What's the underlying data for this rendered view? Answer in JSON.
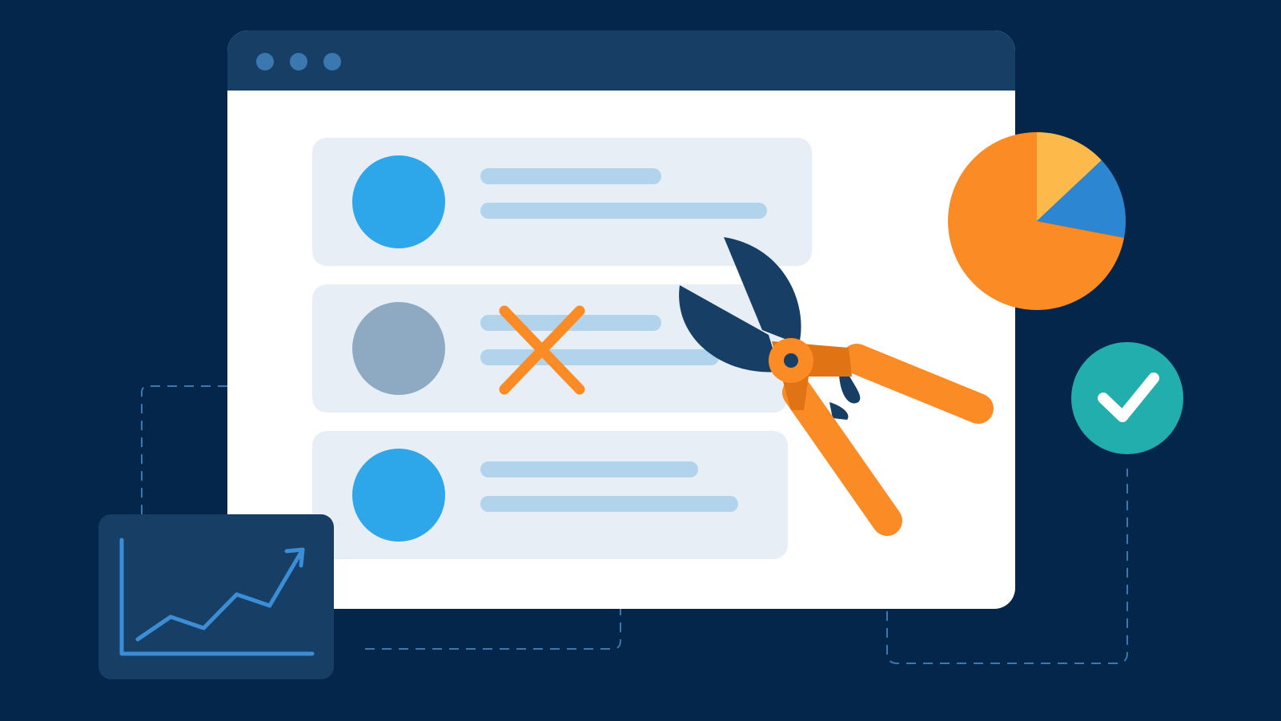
{
  "colors": {
    "background": "#03264a",
    "window_titlebar": "#173f66",
    "window_dots": "#3b78b0",
    "window_body": "#ffffff",
    "card": "#e7eef5",
    "avatar_active": "#2ea6ea",
    "avatar_removed": "#8eaac3",
    "text_line": "#b2d3ec",
    "accent_orange": "#fb8b24",
    "accent_orange_dark": "#e07314",
    "pie_yellow": "#fdba4a",
    "pie_blue": "#2c86d1",
    "shears_blade": "#173f66",
    "check_badge": "#23aeae",
    "chart_panel": "#173f66",
    "chart_line": "#3b8ed6",
    "connector": "#3b78b0"
  },
  "window": {
    "dots": [
      "window-dot-1",
      "window-dot-2",
      "window-dot-3"
    ]
  },
  "list": {
    "items": [
      {
        "state": "kept",
        "avatar_color": "#2ea6ea"
      },
      {
        "state": "removed",
        "avatar_color": "#8eaac3",
        "mark": "x-mark-icon"
      },
      {
        "state": "kept",
        "avatar_color": "#2ea6ea"
      }
    ]
  },
  "icons": {
    "shears": "pruning-shears-icon",
    "check": "checkmark-icon",
    "remove": "x-mark-icon",
    "trend": "trend-up-arrow-icon"
  },
  "pie": {
    "slices": [
      {
        "label": "",
        "value": 0.13,
        "color": "#fdba4a"
      },
      {
        "label": "",
        "value": 0.15,
        "color": "#2c86d1"
      },
      {
        "label": "",
        "value": 0.72,
        "color": "#fb8b24"
      }
    ]
  },
  "trend_chart": {
    "type": "line",
    "points": [
      {
        "x": 0,
        "y": 1
      },
      {
        "x": 1,
        "y": 3
      },
      {
        "x": 2,
        "y": 2
      },
      {
        "x": 3,
        "y": 5
      },
      {
        "x": 4,
        "y": 4
      },
      {
        "x": 5,
        "y": 9
      }
    ],
    "direction": "up"
  }
}
